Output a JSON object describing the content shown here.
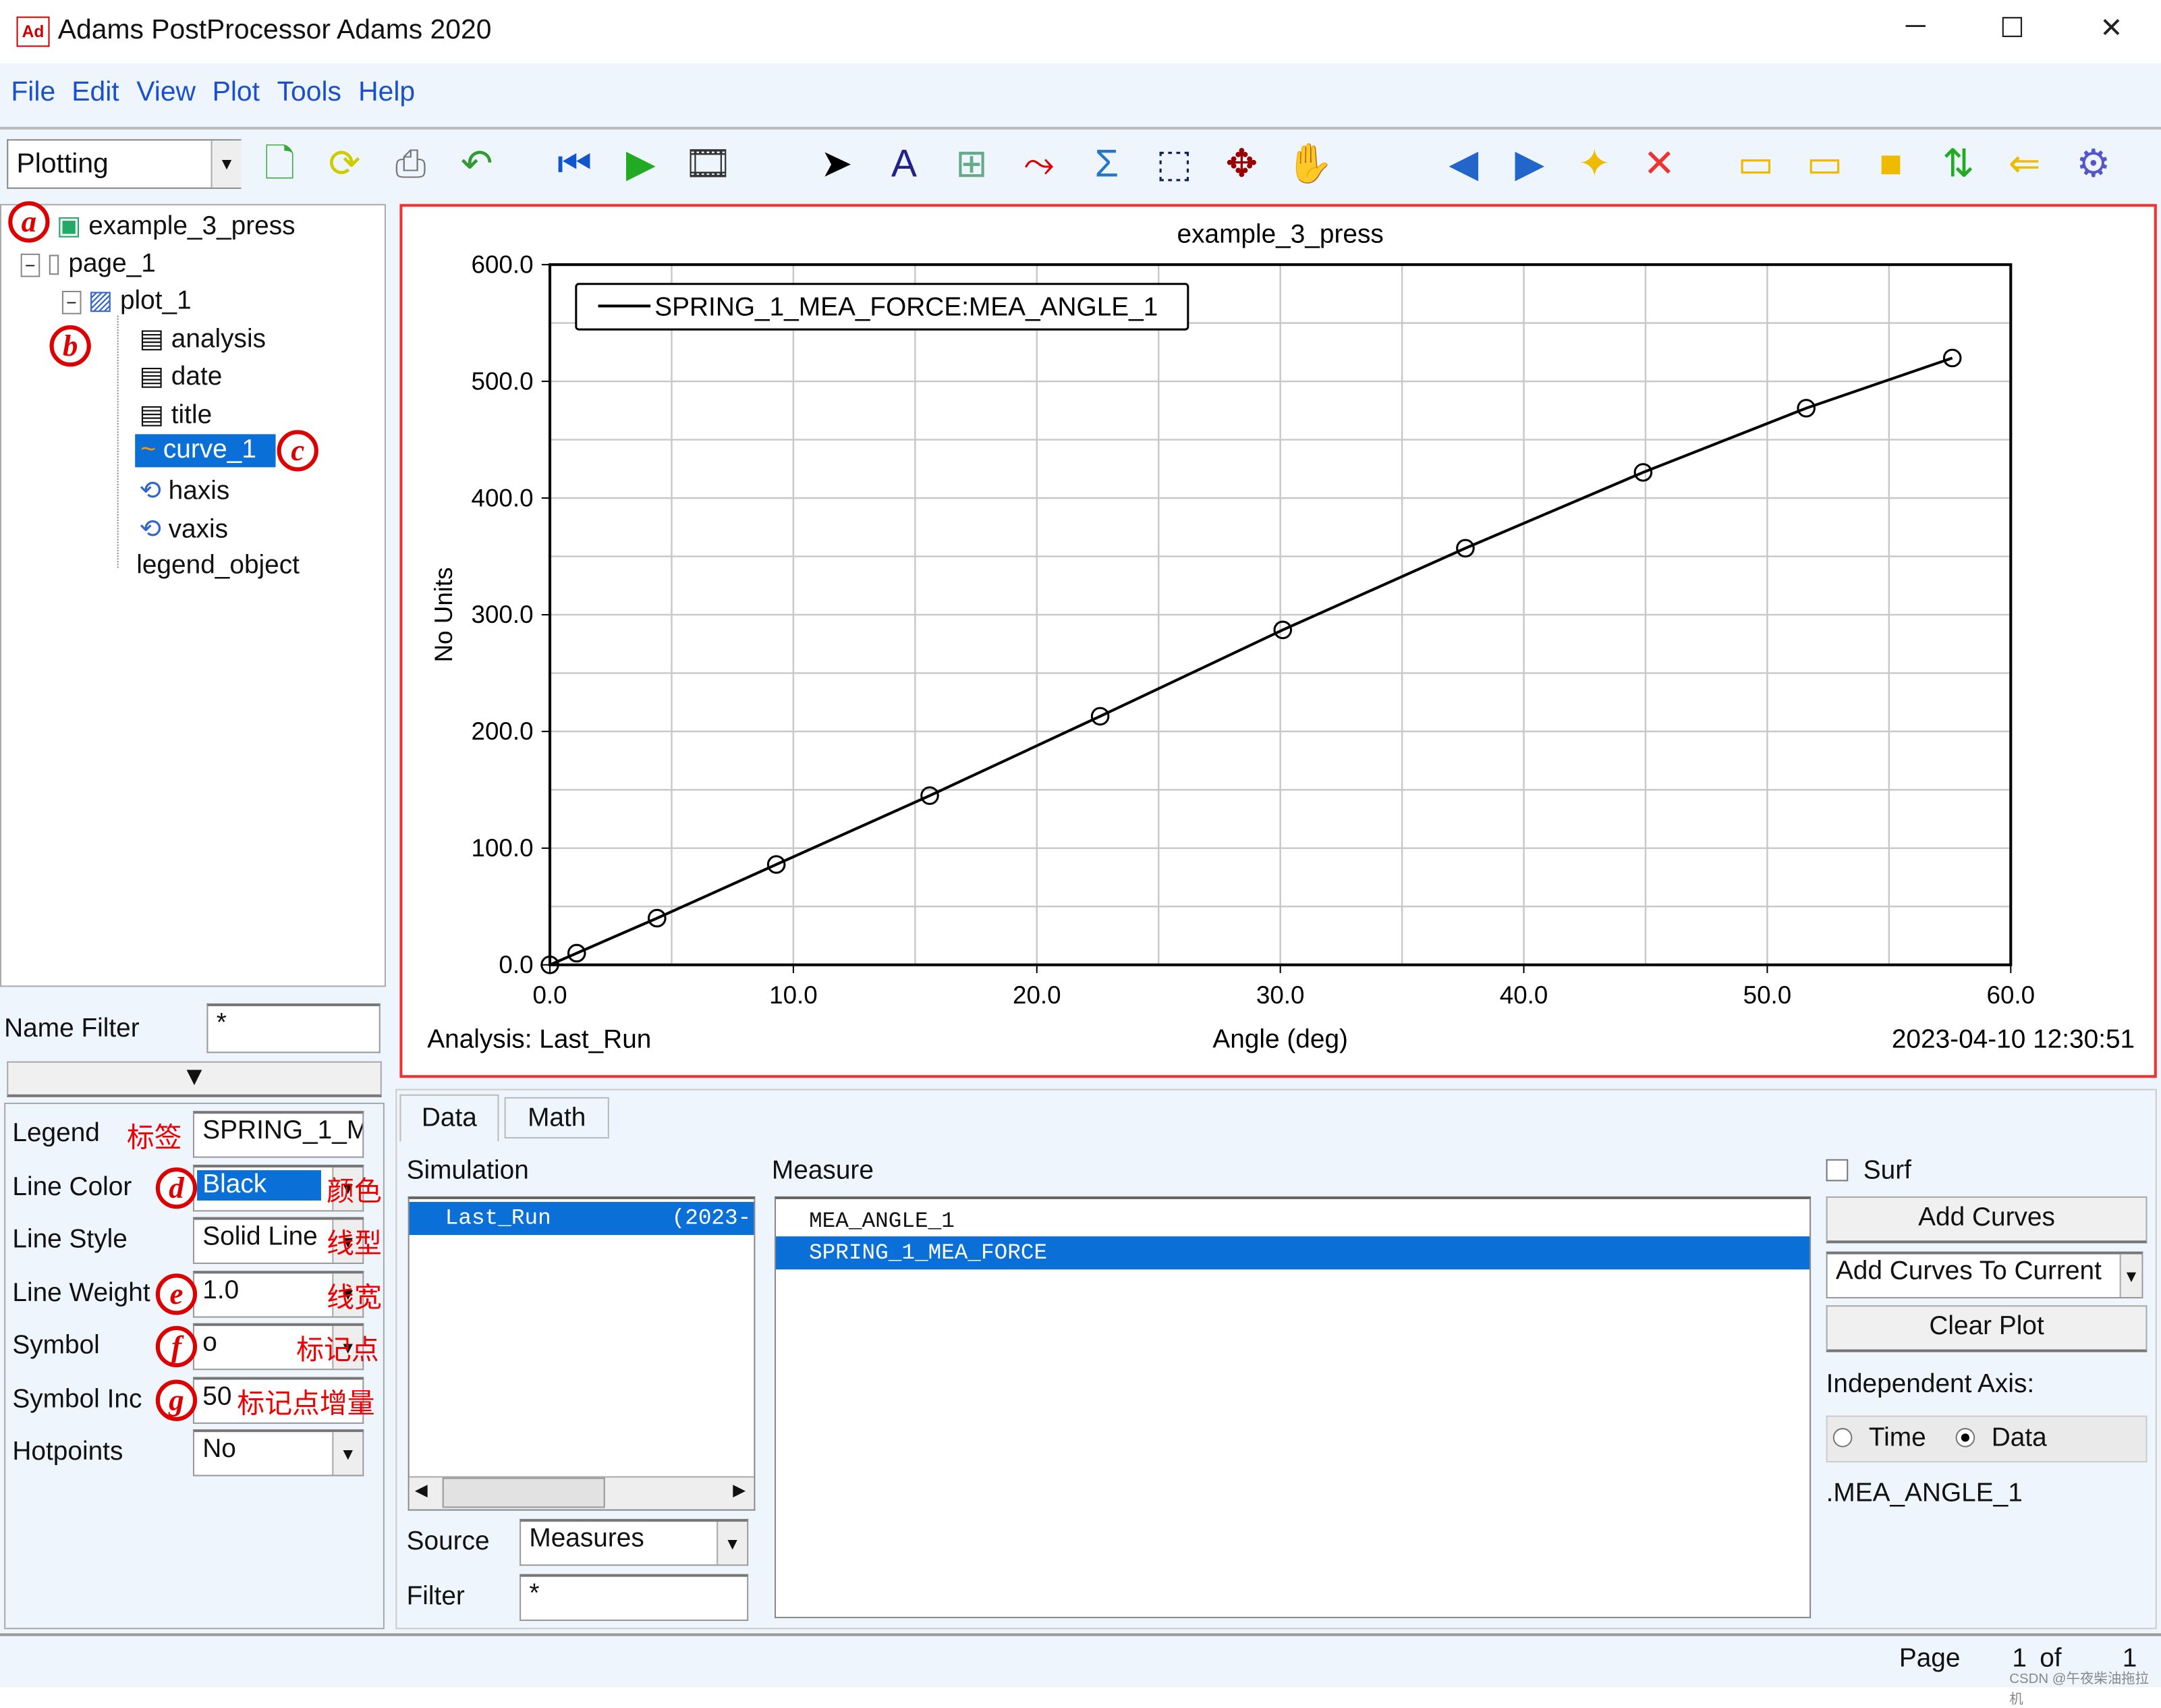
{
  "window": {
    "title": "Adams PostProcessor Adams 2020",
    "icon_text": "Ad",
    "controls": [
      "minimize",
      "maximize",
      "close"
    ]
  },
  "menu": [
    "File",
    "Edit",
    "View",
    "Plot",
    "Tools",
    "Help"
  ],
  "toolbar": {
    "mode": "Plotting",
    "icons": [
      "new-page-icon",
      "reload-icon",
      "print-icon",
      "undo-icon",
      "rewind-icon",
      "play-icon",
      "animation-film-icon",
      "select-arrow-icon",
      "text-icon",
      "axis-icon",
      "curve-edit-icon",
      "sigma-math-icon",
      "zoom-box-icon",
      "fit-icon",
      "pan-hand-icon",
      "prev-page-icon",
      "next-page-icon",
      "new-plot-icon",
      "delete-plot-icon",
      "layout-1-icon",
      "layout-2-icon",
      "layout-3-icon",
      "swap-icon",
      "back-icon",
      "settings-gear-icon"
    ]
  },
  "tree": {
    "root": "example_3_press",
    "page": "page_1",
    "plot": "plot_1",
    "children": [
      "analysis",
      "date",
      "title",
      "curve_1",
      "haxis",
      "vaxis",
      "legend_object"
    ],
    "selected": "curve_1"
  },
  "annotations": {
    "a": "a",
    "b": "b",
    "c": "c",
    "d": "d",
    "e": "e",
    "f": "f",
    "g": "g",
    "legend_cn": "标签",
    "color_cn": "颜色",
    "style_cn": "线型",
    "weight_cn": "线宽",
    "symbol_cn": "标记点",
    "symbol_inc_cn": "标记点增量"
  },
  "name_filter": {
    "label": "Name Filter",
    "value": "*"
  },
  "properties": {
    "legend": {
      "label": "Legend",
      "value": "SPRING_1_M"
    },
    "line_color": {
      "label": "Line Color",
      "value": "Black"
    },
    "line_style": {
      "label": "Line Style",
      "value": "Solid Line"
    },
    "line_weight": {
      "label": "Line Weight",
      "value": "1.0"
    },
    "symbol": {
      "label": "Symbol",
      "value": "o"
    },
    "symbol_inc": {
      "label": "Symbol Inc",
      "value": "50"
    },
    "hotpoints": {
      "label": "Hotpoints",
      "value": "No"
    }
  },
  "chart_data": {
    "type": "line",
    "title": "example_3_press",
    "xlabel": "Angle (deg)",
    "ylabel": "No Units",
    "xlim": [
      0,
      60
    ],
    "ylim": [
      0,
      600
    ],
    "xticks": [
      "0.0",
      "10.0",
      "20.0",
      "30.0",
      "40.0",
      "50.0",
      "60.0"
    ],
    "yticks": [
      "0.0",
      "100.0",
      "200.0",
      "300.0",
      "400.0",
      "500.0",
      "600.0"
    ],
    "grid": true,
    "legend_position": "top-left",
    "series": [
      {
        "name": "SPRING_1_MEA_FORCE:MEA_ANGLE_1",
        "color": "#000000",
        "marker": "circle",
        "x": [
          0,
          1.1,
          4.4,
          9.3,
          15.6,
          22.6,
          30.1,
          37.6,
          44.9,
          51.6,
          57.6
        ],
        "y": [
          0,
          10,
          40,
          86,
          145,
          213,
          287,
          357,
          422,
          477,
          520
        ]
      }
    ],
    "footer_left": "Analysis:  Last_Run",
    "footer_right": "2023-04-10 12:30:51"
  },
  "bottom": {
    "tabs": [
      "Data",
      "Math"
    ],
    "active_tab": "Data",
    "simulation_label": "Simulation",
    "simulation_items": [
      {
        "name": "Last_Run",
        "date": "(2023-"
      }
    ],
    "measure_label": "Measure",
    "measure_items": [
      "MEA_ANGLE_1",
      "SPRING_1_MEA_FORCE"
    ],
    "measure_selected": "SPRING_1_MEA_FORCE",
    "surf_label": "Surf",
    "add_curves": "Add Curves",
    "add_mode": "Add Curves To Current",
    "clear_plot": "Clear Plot",
    "independent_axis_label": "Independent Axis:",
    "radio_time": "Time",
    "radio_data": "Data",
    "independent_selected": "Data",
    "independent_value": ".MEA_ANGLE_1",
    "source_label": "Source",
    "source_value": "Measures",
    "filter_label": "Filter",
    "filter_value": "*"
  },
  "status": {
    "page_label": "Page",
    "page": "1",
    "of_label": "of",
    "total": "1",
    "watermark": "CSDN @午夜柴油拖拉机"
  }
}
